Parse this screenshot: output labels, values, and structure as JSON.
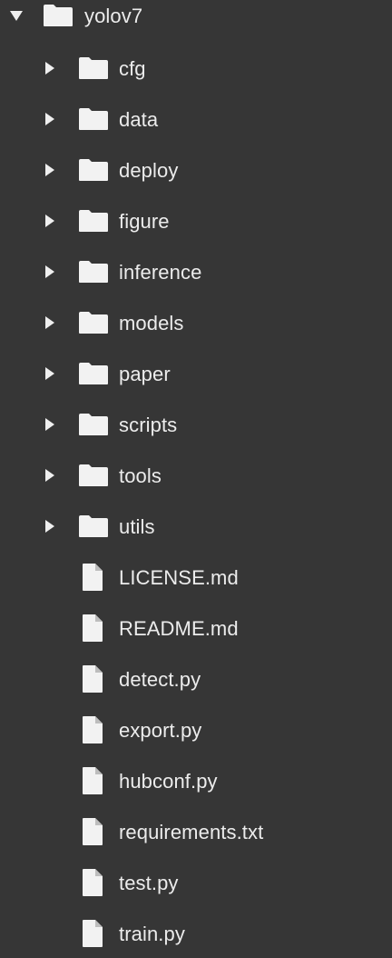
{
  "root": {
    "name": "yolov7",
    "expanded": true
  },
  "folders": [
    {
      "name": "cfg"
    },
    {
      "name": "data"
    },
    {
      "name": "deploy"
    },
    {
      "name": "figure"
    },
    {
      "name": "inference"
    },
    {
      "name": "models"
    },
    {
      "name": "paper"
    },
    {
      "name": "scripts"
    },
    {
      "name": "tools"
    },
    {
      "name": "utils"
    }
  ],
  "files": [
    {
      "name": "LICENSE.md"
    },
    {
      "name": "README.md"
    },
    {
      "name": "detect.py"
    },
    {
      "name": "export.py"
    },
    {
      "name": "hubconf.py"
    },
    {
      "name": "requirements.txt"
    },
    {
      "name": "test.py"
    },
    {
      "name": "train.py"
    }
  ]
}
